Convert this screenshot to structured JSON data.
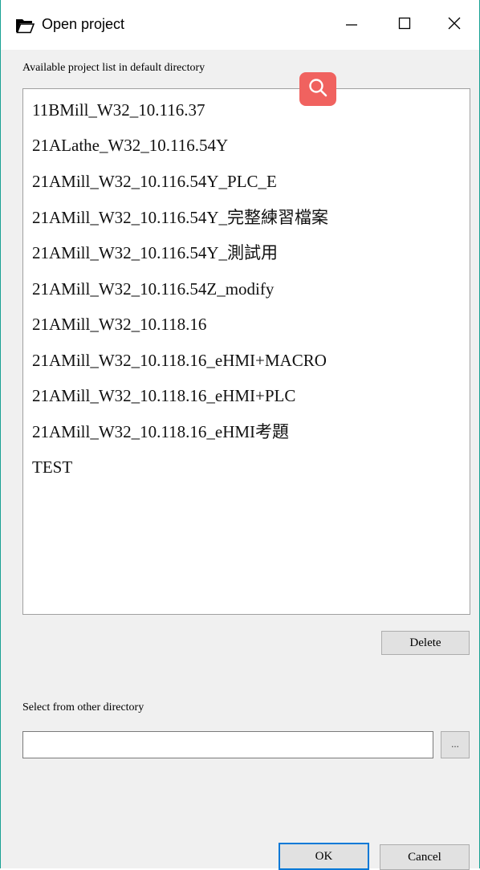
{
  "window": {
    "title": "Open project",
    "accent_color": "#1aa294"
  },
  "available_label": "Available project list in default directory",
  "projects": [
    "11BMill_W32_10.116.37",
    "21ALathe_W32_10.116.54Y",
    "21AMill_W32_10.116.54Y_PLC_E",
    "21AMill_W32_10.116.54Y_完整練習檔案",
    "21AMill_W32_10.116.54Y_測試用",
    "21AMill_W32_10.116.54Z_modify",
    "21AMill_W32_10.118.16",
    "21AMill_W32_10.118.16_eHMI+MACRO",
    "21AMill_W32_10.118.16_eHMI+PLC",
    "21AMill_W32_10.118.16_eHMI考題",
    "TEST"
  ],
  "buttons": {
    "delete": "Delete",
    "browse": "...",
    "ok": "OK",
    "cancel": "Cancel"
  },
  "other_dir": {
    "label": "Select from other directory",
    "value": "",
    "placeholder": ""
  },
  "icons": {
    "title": "folder-icon",
    "overlay": "search-icon",
    "minimize": "minimize-icon",
    "maximize": "maximize-icon",
    "close": "close-icon"
  },
  "colors": {
    "ok_border": "#0078d7",
    "search_badge": "#f0625f"
  }
}
